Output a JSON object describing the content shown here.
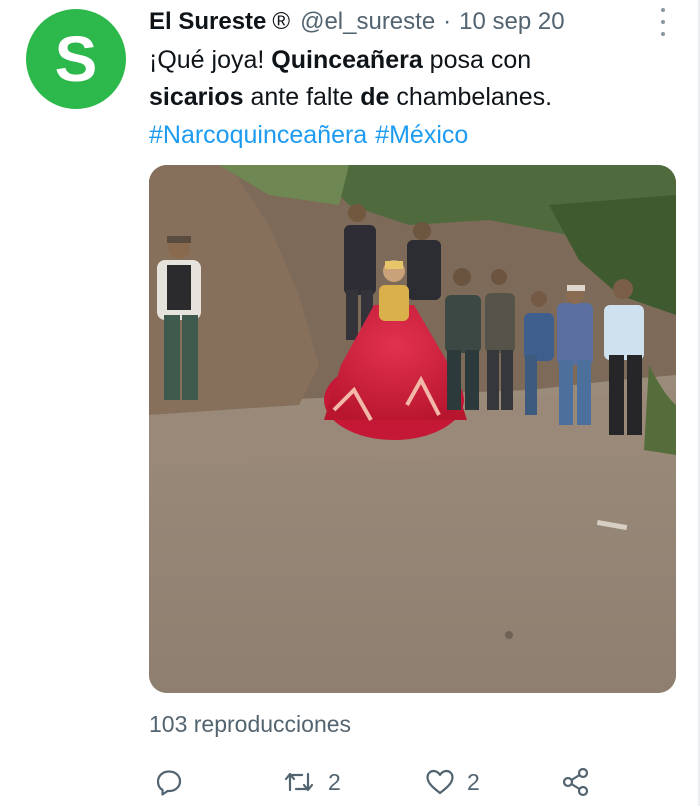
{
  "author": {
    "avatar_letter": "S",
    "avatar_color": "#2cb84a",
    "name": "El Sureste",
    "registered_mark": "®",
    "handle": "@el_sureste",
    "separator": "·",
    "date": "10 sep 20"
  },
  "tweet": {
    "line1_a": "¡Qué joya! ",
    "line1_b": "Quinceañera",
    "line1_c": " posa con",
    "line2_a": "sicarios",
    "line2_b": " ante falte ",
    "line2_c": "de",
    "line2_d": " chambelanes.",
    "hashtags": [
      "#Narcoquinceañera",
      "#México"
    ]
  },
  "media": {
    "type": "video"
  },
  "stats": {
    "views": "103 reproducciones",
    "retweets": "2",
    "likes": "2"
  },
  "icons": [
    "reply-icon",
    "retweet-icon",
    "like-icon",
    "share-icon",
    "more-icon"
  ],
  "colors": {
    "link": "#1d9bf0",
    "muted": "#536471",
    "dress": "#d01f3c"
  }
}
